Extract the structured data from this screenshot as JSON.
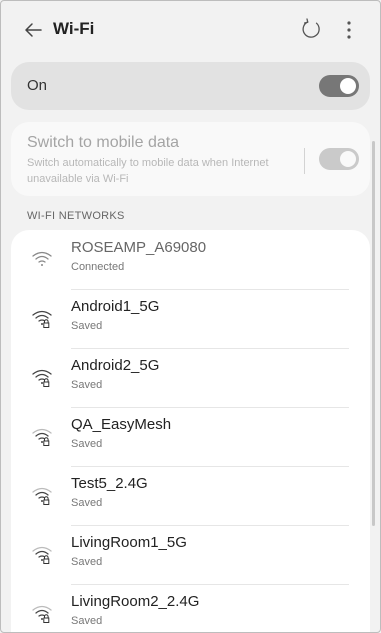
{
  "header": {
    "title": "Wi-Fi",
    "back_icon": "arrow-left-icon",
    "refresh_icon": "refresh-icon",
    "more_icon": "more-vertical-icon"
  },
  "wifi_toggle": {
    "label": "On",
    "state": "on"
  },
  "mobile_data": {
    "title": "Switch to mobile data",
    "subtitle": "Switch automatically to mobile data when Internet unavailable via Wi-Fi",
    "state": "on",
    "enabled": false
  },
  "networks_section": {
    "label": "WI-FI NETWORKS"
  },
  "networks": [
    {
      "name": "ROSEAMP_A69080",
      "status": "Connected",
      "secured": false,
      "strength": "full"
    },
    {
      "name": "Android1_5G",
      "status": "Saved",
      "secured": true,
      "strength": "full"
    },
    {
      "name": "Android2_5G",
      "status": "Saved",
      "secured": true,
      "strength": "full"
    },
    {
      "name": "QA_EasyMesh",
      "status": "Saved",
      "secured": true,
      "strength": "medium"
    },
    {
      "name": "Test5_2.4G",
      "status": "Saved",
      "secured": true,
      "strength": "medium"
    },
    {
      "name": "LivingRoom1_5G",
      "status": "Saved",
      "secured": true,
      "strength": "medium"
    },
    {
      "name": "LivingRoom2_2.4G",
      "status": "Saved",
      "secured": true,
      "strength": "medium"
    }
  ],
  "colors": {
    "background": "#f2f2f2",
    "card": "#ffffff",
    "toggle_on": "#777777"
  }
}
